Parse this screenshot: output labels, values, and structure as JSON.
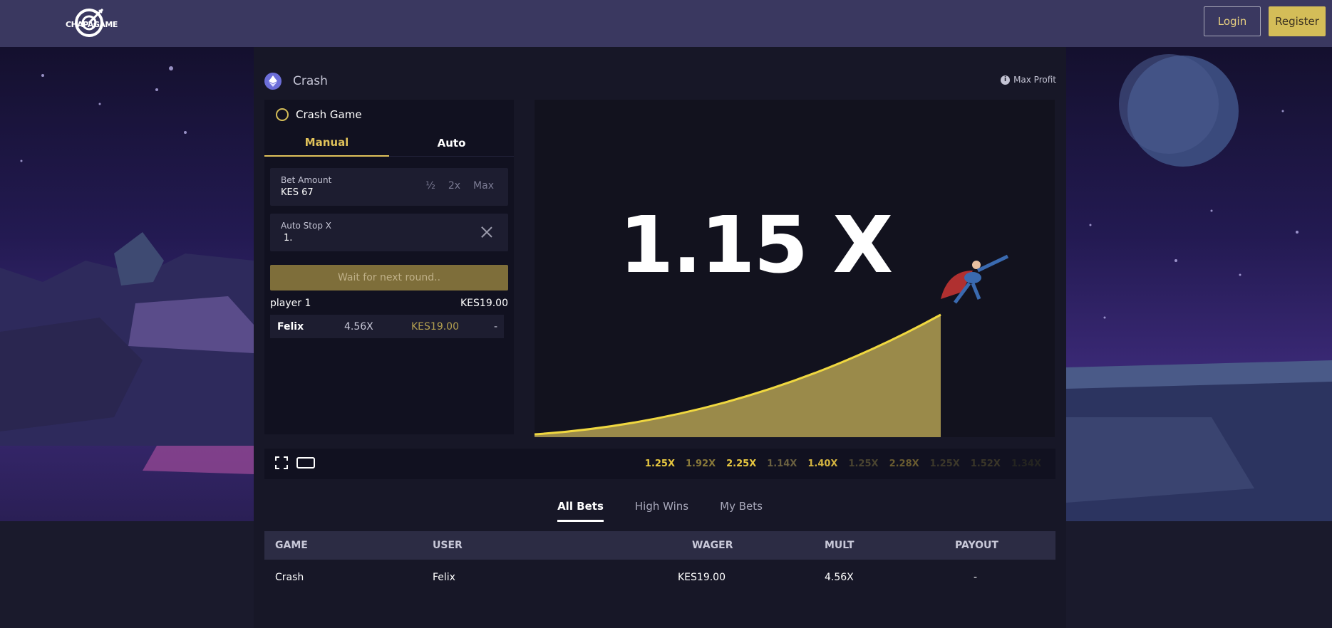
{
  "header": {
    "logo_text": "CHAPAGAME",
    "login_label": "Login",
    "register_label": "Register"
  },
  "game": {
    "title": "Crash",
    "max_profit_label": "Max Profit",
    "panel_title": "Crash Game",
    "tabs": [
      "Manual",
      "Auto"
    ],
    "bet_amount_label": "Bet Amount",
    "bet_amount_value": "KES 67",
    "quick_buttons": [
      "½",
      "2x",
      "Max"
    ],
    "auto_stop_label": "Auto Stop X",
    "auto_stop_value": "1.",
    "wait_button_label": "Wait for next round..",
    "player_label": "player 1",
    "player_total": "KES19.00",
    "bet": {
      "user": "Felix",
      "mult": "4.56X",
      "amount": "KES19.00",
      "payout": "-"
    },
    "multiplier": "1.15 X"
  },
  "history": [
    {
      "value": "1.25X",
      "color": "#e8c840"
    },
    {
      "value": "1.92X",
      "color": "#8a7a3a"
    },
    {
      "value": "2.25X",
      "color": "#e8c840"
    },
    {
      "value": "1.14X",
      "color": "#6a6040"
    },
    {
      "value": "1.40X",
      "color": "#d4b440"
    },
    {
      "value": "1.25X",
      "color": "#4a4430"
    },
    {
      "value": "2.28X",
      "color": "#6a5c30"
    },
    {
      "value": "1.25X",
      "color": "#3c382a"
    },
    {
      "value": "1.52X",
      "color": "#3a3628"
    },
    {
      "value": "1.34X",
      "color": "#242420"
    }
  ],
  "bets_tabs": [
    "All Bets",
    "High Wins",
    "My Bets"
  ],
  "table": {
    "headers": [
      "GAME",
      "USER",
      "WAGER",
      "MULT",
      "PAYOUT"
    ],
    "rows": [
      {
        "game": "Crash",
        "user": "Felix",
        "wager": "KES19.00",
        "mult": "4.56X",
        "payout": "-"
      }
    ]
  },
  "colors": {
    "accent": "#e0c25a",
    "curve_fill": "#9a8a4a",
    "curve_line": "#f0d840"
  }
}
